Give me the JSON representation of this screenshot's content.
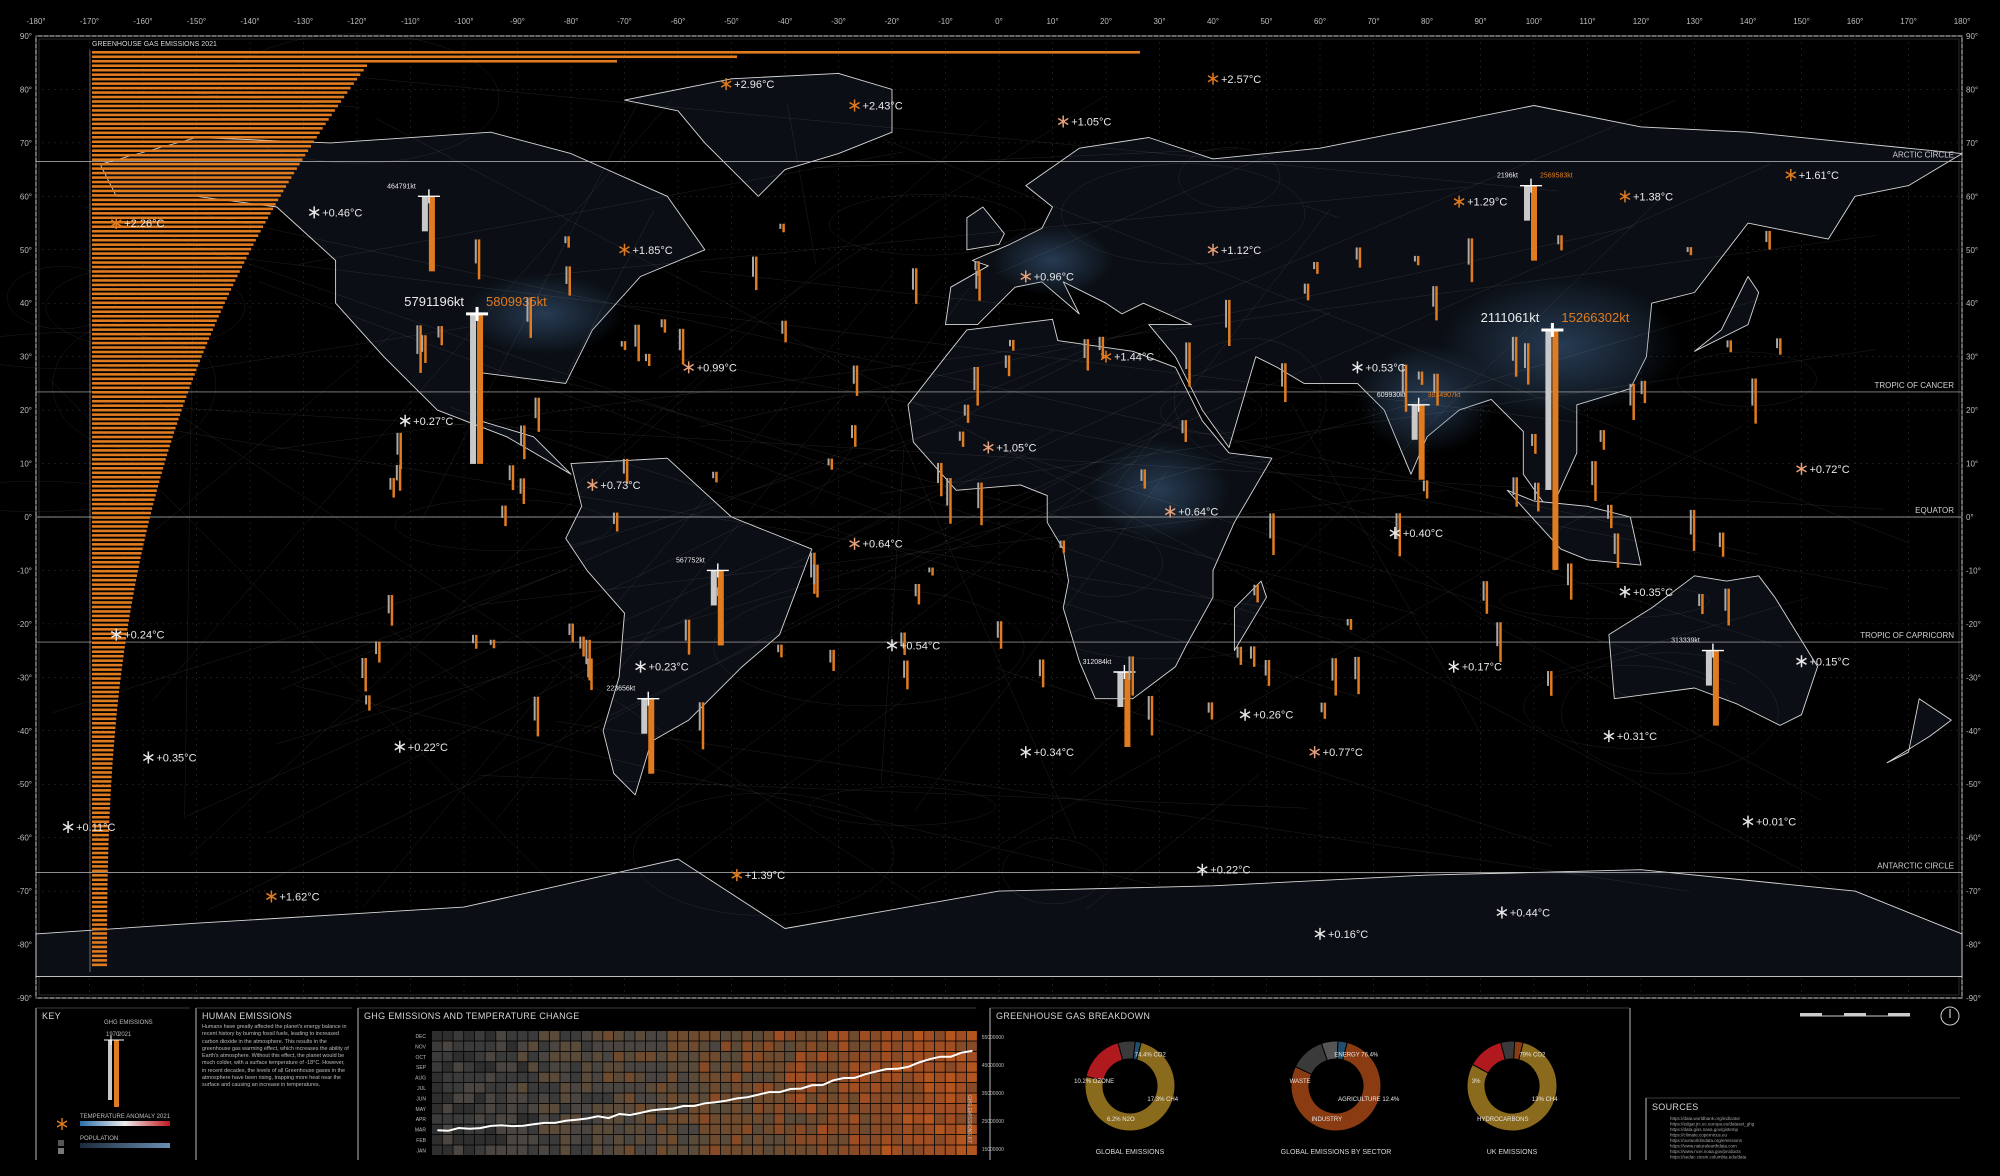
{
  "map": {
    "title": "GREENHOUSE GAS EMISSIONS 2021",
    "accent": "#e07b1f",
    "lat_ticks": [
      "90°",
      "80°",
      "70°",
      "60°",
      "50°",
      "40°",
      "30°",
      "20°",
      "10°",
      "0°",
      "-10°",
      "-20°",
      "-30°",
      "-40°",
      "-50°",
      "-60°",
      "-70°",
      "-80°",
      "-90°"
    ],
    "lon_ticks": [
      "-180°",
      "-170°",
      "-160°",
      "-150°",
      "-140°",
      "-130°",
      "-120°",
      "-110°",
      "-100°",
      "-90°",
      "-80°",
      "-70°",
      "-60°",
      "-50°",
      "-40°",
      "-30°",
      "-20°",
      "-10°",
      "0°",
      "10°",
      "20°",
      "30°",
      "40°",
      "50°",
      "60°",
      "70°",
      "80°",
      "90°",
      "100°",
      "110°",
      "120°",
      "130°",
      "140°",
      "150°",
      "160°",
      "170°",
      "180°"
    ],
    "lines": [
      {
        "name": "ARCTIC CIRCLE",
        "lat": 66.5
      },
      {
        "name": "TROPIC OF CANCER",
        "lat": 23.4
      },
      {
        "name": "EQUATOR",
        "lat": 0
      },
      {
        "name": "TROPIC OF CAPRICORN",
        "lat": -23.4
      },
      {
        "name": "ANTARCTIC CIRCLE",
        "lat": -66.5
      }
    ],
    "emission_labels": [
      {
        "lon": -97,
        "lat": 38,
        "v1970": "5791196kt",
        "v2021": "5809935kt",
        "big": true
      },
      {
        "lon": 104,
        "lat": 35,
        "v1970": "2111061kt",
        "v2021": "15266302kt",
        "big": true
      },
      {
        "lon": 79,
        "lat": 21,
        "v1970": "609930kt",
        "v2021": "3834907kt",
        "big": false
      },
      {
        "lon": -106,
        "lat": 60,
        "v1970": "464791kt",
        "v2021": "",
        "big": false
      },
      {
        "lon": 100,
        "lat": 62,
        "v1970": "2196kt",
        "v2021": "2569583kt",
        "big": false
      },
      {
        "lon": -52,
        "lat": -10,
        "v1970": "567752kt",
        "v2021": "",
        "big": false
      },
      {
        "lon": -65,
        "lat": -34,
        "v1970": "223656kt",
        "v2021": "",
        "big": false
      },
      {
        "lon": 24,
        "lat": -29,
        "v1970": "312084kt",
        "v2021": "",
        "big": false
      },
      {
        "lon": 134,
        "lat": -25,
        "v1970": "313339kt",
        "v2021": "",
        "big": false
      }
    ],
    "temp_labels": [
      {
        "lon": -51,
        "lat": 81,
        "text": "+2.96°C"
      },
      {
        "lon": -27,
        "lat": 77,
        "text": "+2.43°C"
      },
      {
        "lon": 40,
        "lat": 82,
        "text": "+2.57°C"
      },
      {
        "lon": 12,
        "lat": 74,
        "text": "+1.05°C"
      },
      {
        "lon": 148,
        "lat": 64,
        "text": "+1.61°C"
      },
      {
        "lon": -128,
        "lat": 57,
        "text": "+0.46°C"
      },
      {
        "lon": -165,
        "lat": 55,
        "text": "+2.26°C"
      },
      {
        "lon": 86,
        "lat": 59,
        "text": "+1.29°C"
      },
      {
        "lon": 117,
        "lat": 60,
        "text": "+1.38°C"
      },
      {
        "lon": -70,
        "lat": 50,
        "text": "+1.85°C"
      },
      {
        "lon": 40,
        "lat": 50,
        "text": "+1.12°C"
      },
      {
        "lon": 5,
        "lat": 45,
        "text": "+0.96°C"
      },
      {
        "lon": -58,
        "lat": 28,
        "text": "+0.99°C"
      },
      {
        "lon": 67,
        "lat": 28,
        "text": "+0.53°C"
      },
      {
        "lon": 20,
        "lat": 30,
        "text": "+1.44°C"
      },
      {
        "lon": -111,
        "lat": 18,
        "text": "+0.27°C"
      },
      {
        "lon": -2,
        "lat": 13,
        "text": "+1.05°C"
      },
      {
        "lon": -76,
        "lat": 6,
        "text": "+0.73°C"
      },
      {
        "lon": 150,
        "lat": 9,
        "text": "+0.72°C"
      },
      {
        "lon": 32,
        "lat": 1,
        "text": "+0.64°C"
      },
      {
        "lon": -27,
        "lat": -5,
        "text": "+0.64°C"
      },
      {
        "lon": 74,
        "lat": -3,
        "text": "+0.40°C"
      },
      {
        "lon": 117,
        "lat": -14,
        "text": "+0.35°C"
      },
      {
        "lon": -165,
        "lat": -22,
        "text": "+0.24°C"
      },
      {
        "lon": -20,
        "lat": -24,
        "text": "+0.54°C"
      },
      {
        "lon": -67,
        "lat": -28,
        "text": "+0.23°C"
      },
      {
        "lon": 85,
        "lat": -28,
        "text": "+0.17°C"
      },
      {
        "lon": 150,
        "lat": -27,
        "text": "+0.15°C"
      },
      {
        "lon": 46,
        "lat": -37,
        "text": "+0.26°C"
      },
      {
        "lon": 114,
        "lat": -41,
        "text": "+0.31°C"
      },
      {
        "lon": -112,
        "lat": -43,
        "text": "+0.22°C"
      },
      {
        "lon": -159,
        "lat": -45,
        "text": "+0.35°C"
      },
      {
        "lon": 5,
        "lat": -44,
        "text": "+0.34°C"
      },
      {
        "lon": 59,
        "lat": -44,
        "text": "+0.77°C"
      },
      {
        "lon": 140,
        "lat": -57,
        "text": "+0.01°C"
      },
      {
        "lon": -174,
        "lat": -58,
        "text": "+0.11°C"
      },
      {
        "lon": 38,
        "lat": -66,
        "text": "+0.22°C"
      },
      {
        "lon": -49,
        "lat": -67,
        "text": "+1.39°C"
      },
      {
        "lon": -136,
        "lat": -71,
        "text": "+1.62°C"
      },
      {
        "lon": 94,
        "lat": -74,
        "text": "+0.44°C"
      },
      {
        "lon": 60,
        "lat": -78,
        "text": "+0.16°C"
      }
    ]
  },
  "key": {
    "title": "KEY",
    "ghg_label": "GHG EMISSIONS",
    "year_a": "1970",
    "year_b": "2021",
    "temp_label": "TEMPERATURE ANOMALY 2021",
    "pop_label": "POPULATION"
  },
  "human": {
    "title": "HUMAN EMISSIONS",
    "text": "Humans have greatly affected the planet's energy balance in recent history by burning fossil fuels, leading to increased carbon dioxide in the atmosphere. This results in the greenhouse gas warming effect, which increases the ability of Earth's atmosphere. Without this effect, the planet would be much colder, with a surface temperature of -18°C. However, in recent decades, the levels of all Greenhouse gases in the atmosphere have been rising, trapping more heat near the surface and causing an increase in temperatures."
  },
  "heatmap": {
    "title": "GHG EMISSIONS AND TEMPERATURE CHANGE",
    "months": [
      "DEC",
      "NOV",
      "OCT",
      "SEP",
      "AUG",
      "JUL",
      "JUN",
      "MAY",
      "APR",
      "MAR",
      "FEB",
      "JAN"
    ],
    "ylabel_right": "GHG EMISSIONS KT",
    "yticks_right": [
      "55000000",
      "45000000",
      "35000000",
      "25000000",
      "15000000"
    ]
  },
  "breakdown": {
    "title": "GREENHOUSE GAS BREAKDOWN",
    "donuts": [
      {
        "name": "GLOBAL EMISSIONS",
        "segments": [
          {
            "label": "CO2",
            "value": 74.4,
            "color": "#8a6a1c"
          },
          {
            "label": "CH4",
            "value": 17.3,
            "color": "#b0191e"
          },
          {
            "label": "N2O",
            "value": 6.2,
            "color": "#3a3a3a"
          },
          {
            "label": "F-GAS",
            "value": 2.1,
            "color": "#1f4f6d"
          }
        ],
        "labels": [
          "74.4% CO2",
          "17.3% CH4",
          "6.2% N2O",
          "10.2% OZONE"
        ]
      },
      {
        "name": "GLOBAL EMISSIONS BY SECTOR",
        "segments": [
          {
            "label": "ENERGY",
            "value": 76.4,
            "color": "#8a3b12"
          },
          {
            "label": "AGRICULTURE",
            "value": 12.4,
            "color": "#3a3a3a"
          },
          {
            "label": "INDUSTRY",
            "value": 5.8,
            "color": "#555555"
          },
          {
            "label": "WASTE",
            "value": 3.2,
            "color": "#1f4f6d"
          }
        ],
        "labels": [
          "ENERGY 76.4%",
          "AGRICULTURE 12.4%",
          "INDUSTRY",
          "WASTE"
        ]
      },
      {
        "name": "UK EMISSIONS",
        "segments": [
          {
            "label": "CO2",
            "value": 79,
            "color": "#8a6a1c"
          },
          {
            "label": "CH4",
            "value": 13,
            "color": "#b0191e"
          },
          {
            "label": "N2O",
            "value": 5,
            "color": "#3a3a3a"
          },
          {
            "label": "HFC",
            "value": 3,
            "color": "#8a3b12"
          }
        ],
        "labels": [
          "79% CO2",
          "13% CH4",
          "HYDROCARBONS",
          "3%"
        ]
      }
    ]
  },
  "sources": {
    "title": "SOURCES",
    "items": [
      "https://data.worldbank.org/indicator",
      "https://edgar.jrc.ec.europa.eu/dataset_ghg",
      "https://data.giss.nasa.gov/gistemp",
      "https://climate.copernicus.eu",
      "https://ourworldindata.org/emissions",
      "https://www.naturalearthdata.com",
      "https://www.ncei.noaa.gov/products",
      "https://sedac.ciesin.columbia.edu/data"
    ]
  }
}
